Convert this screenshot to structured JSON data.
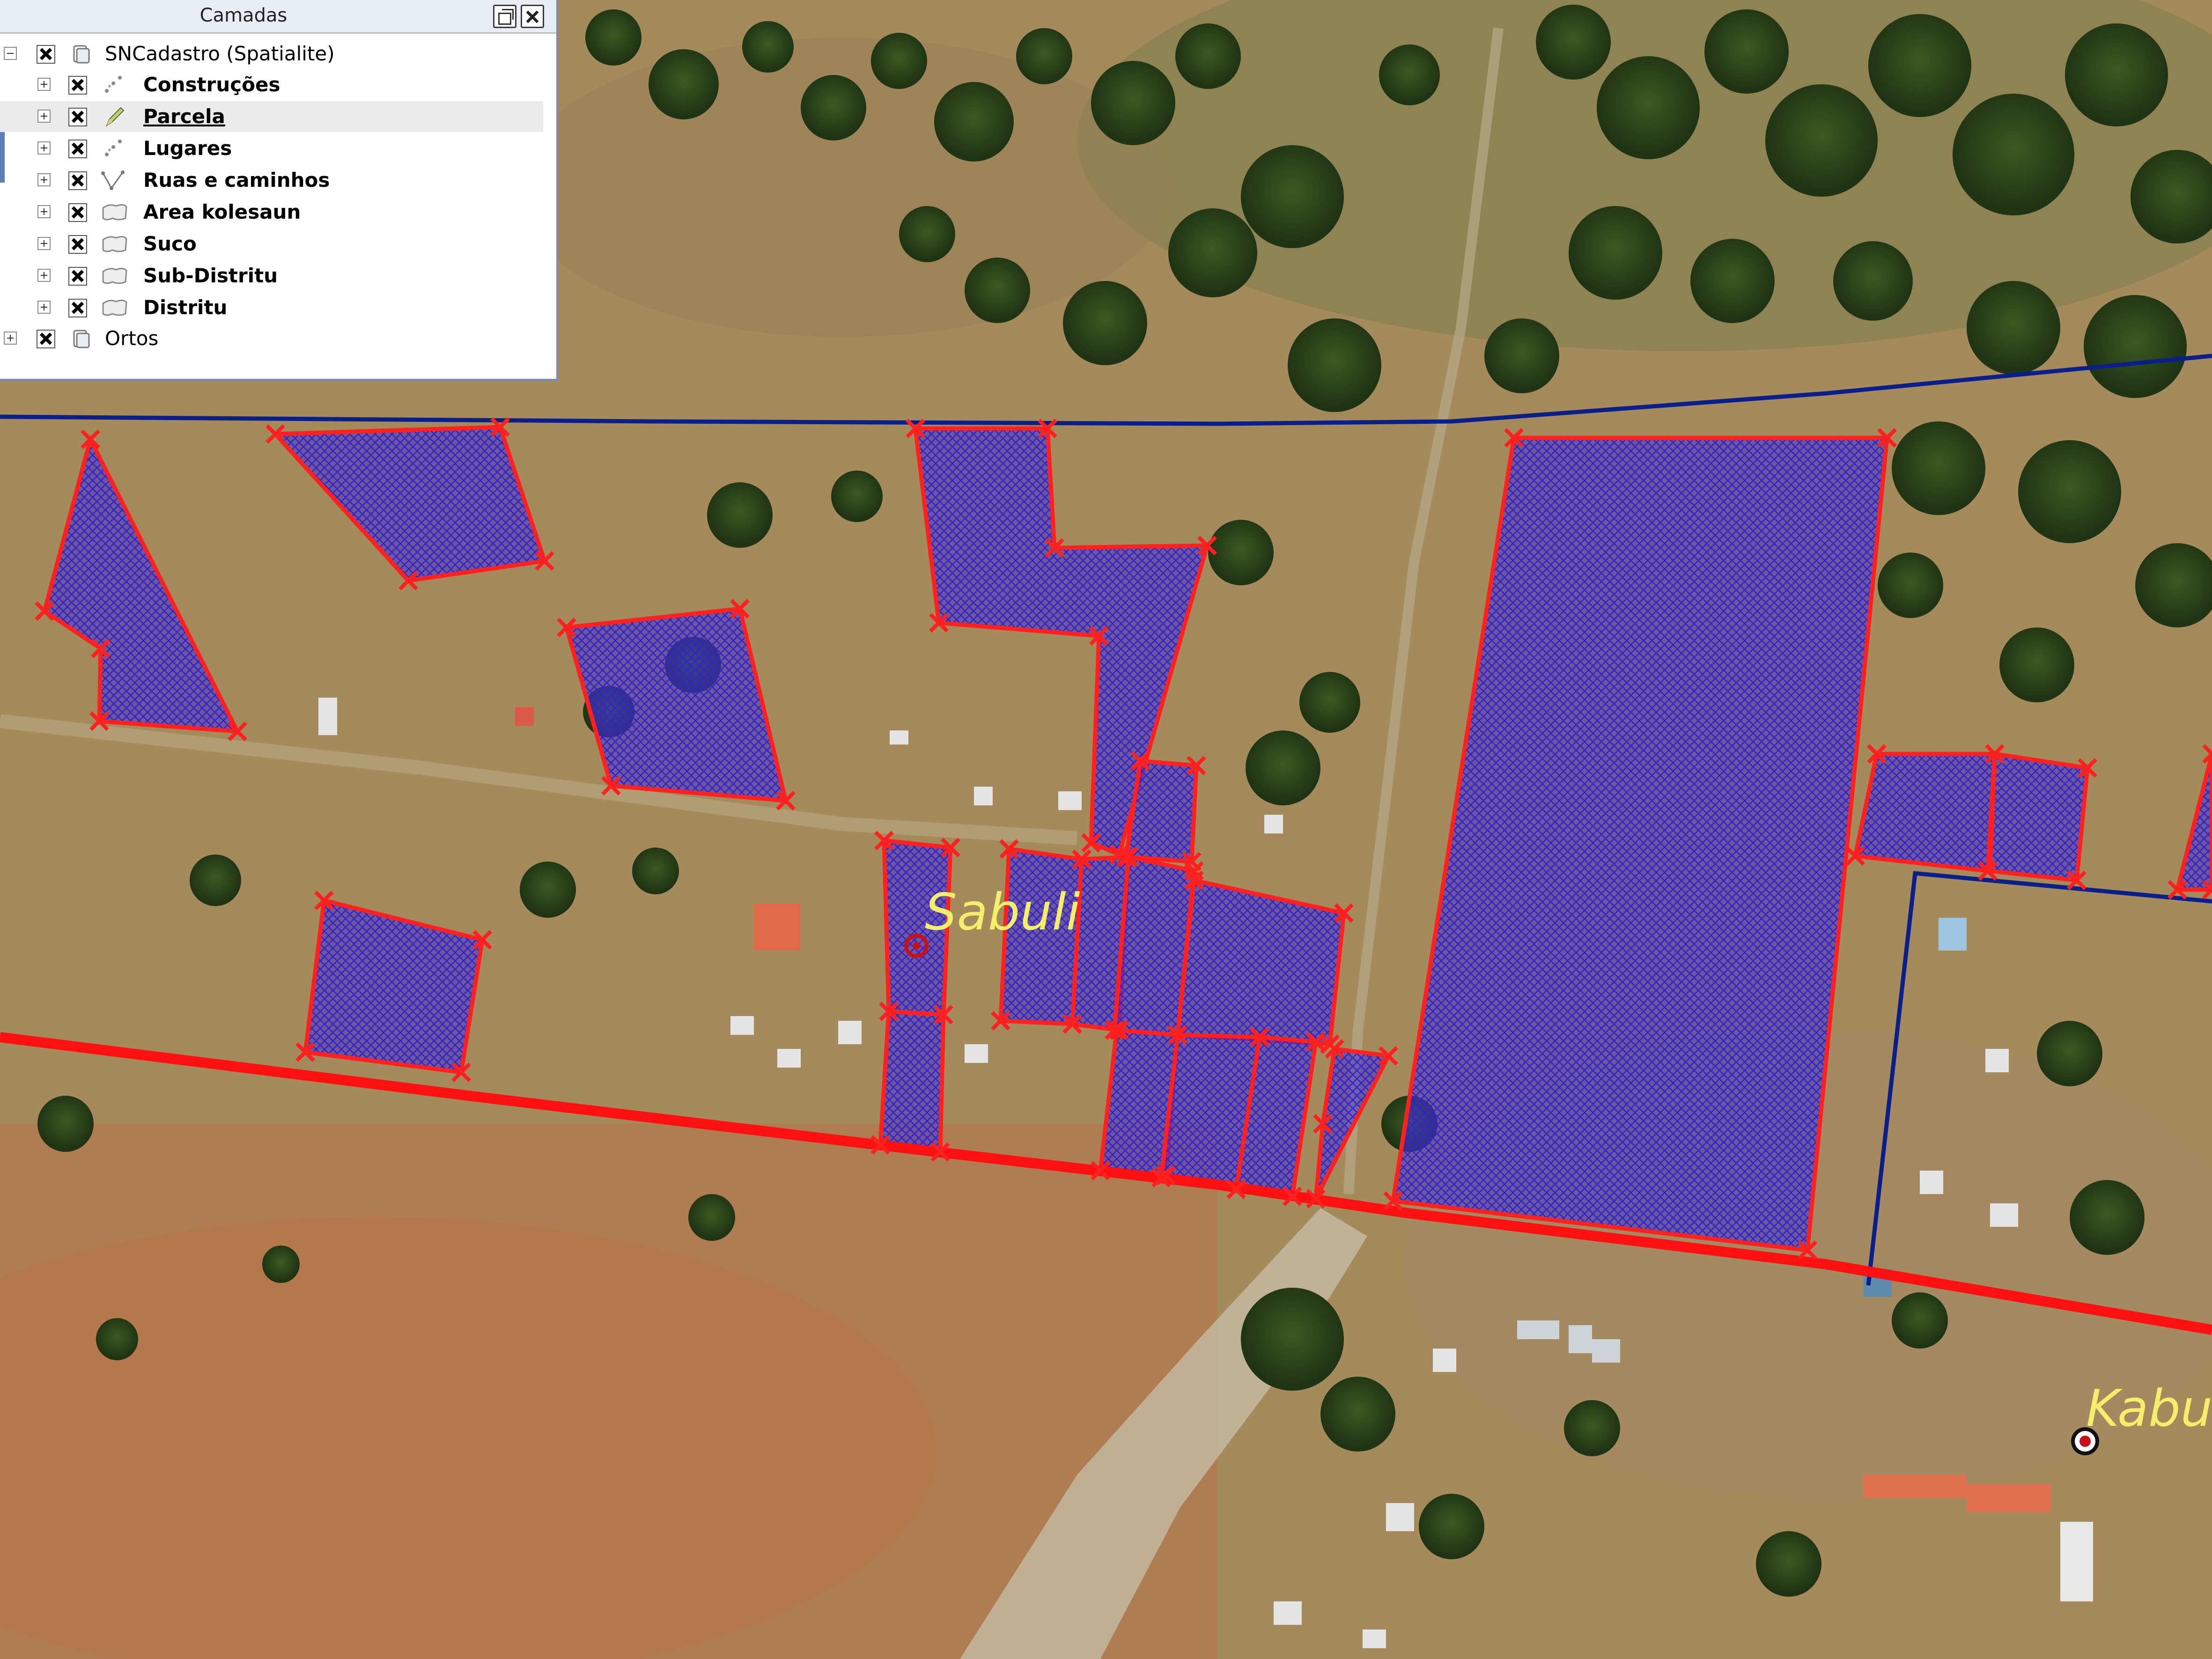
{
  "panel": {
    "title": "Camadas",
    "groups": [
      {
        "label": "SNCadastro (Spatialite)",
        "icon": "layer-group-icon",
        "checked": true,
        "expanded": true,
        "layers": [
          {
            "label": "Construções",
            "icon": "point-layer-icon",
            "checked": true
          },
          {
            "label": "Parcela",
            "icon": "edit-pencil-icon",
            "checked": true,
            "selected": true
          },
          {
            "label": "Lugares",
            "icon": "point-layer-icon",
            "checked": true
          },
          {
            "label": "Ruas e caminhos",
            "icon": "line-layer-icon",
            "checked": true
          },
          {
            "label": "Area kolesaun",
            "icon": "polygon-layer-icon",
            "checked": true
          },
          {
            "label": "Suco",
            "icon": "polygon-layer-icon",
            "checked": true
          },
          {
            "label": "Sub-Distritu",
            "icon": "polygon-layer-icon",
            "checked": true
          },
          {
            "label": "Distritu",
            "icon": "polygon-layer-icon",
            "checked": true
          }
        ]
      },
      {
        "label": "Ortos",
        "icon": "layer-group-icon",
        "checked": true,
        "expanded": false,
        "layers": []
      }
    ]
  },
  "map": {
    "places": [
      {
        "label": "Sabuli"
      },
      {
        "label": "Kabul"
      }
    ],
    "colors": {
      "parcel_fill": "#2a2ad8",
      "parcel_outline": "#ff2020",
      "main_road": "#ff1010",
      "secondary_road": "#0b1f8a",
      "vertex_marker": "#ff2020",
      "place_label": "#f4ee6a"
    }
  }
}
